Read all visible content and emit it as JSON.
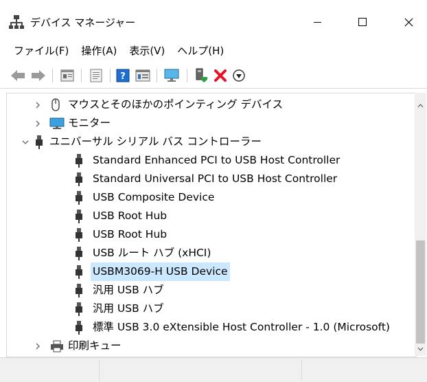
{
  "title": "デバイス マネージャー",
  "menu": [
    {
      "label": "ファイル(F)"
    },
    {
      "label": "操作(A)"
    },
    {
      "label": "表示(V)"
    },
    {
      "label": "ヘルプ(H)"
    }
  ],
  "toolbar_icons": [
    "back-icon",
    "forward-icon",
    "properties-icon",
    "update-icon",
    "help-icon",
    "view-icon",
    "monitor-icon",
    "enable-icon",
    "remove-icon",
    "install-icon"
  ],
  "tree": {
    "rows": [
      {
        "label": "マウスとそのほかのポインティング デバイス",
        "expanded": false,
        "level": 0,
        "icon": "mouse-icon"
      },
      {
        "label": "モニター",
        "expanded": false,
        "level": 0,
        "icon": "monitor-icon"
      },
      {
        "label": "ユニバーサル シリアル バス コントローラー",
        "expanded": true,
        "level": 0,
        "icon": "usb-icon"
      },
      {
        "label": "Standard Enhanced PCI to USB Host Controller",
        "level": 1,
        "icon": "usb-icon"
      },
      {
        "label": "Standard Universal PCI to USB Host Controller",
        "level": 1,
        "icon": "usb-icon"
      },
      {
        "label": "USB Composite Device",
        "level": 1,
        "icon": "usb-icon"
      },
      {
        "label": "USB Root Hub",
        "level": 1,
        "icon": "usb-icon"
      },
      {
        "label": "USB Root Hub",
        "level": 1,
        "icon": "usb-icon"
      },
      {
        "label": "USB ルート ハブ (xHCI)",
        "level": 1,
        "icon": "usb-icon"
      },
      {
        "label": "USBM3069-H USB Device",
        "level": 1,
        "icon": "usb-icon",
        "selected": true
      },
      {
        "label": "汎用 USB ハブ",
        "level": 1,
        "icon": "usb-icon"
      },
      {
        "label": "汎用 USB ハブ",
        "level": 1,
        "icon": "usb-icon"
      },
      {
        "label": "標準 USB 3.0 eXtensible Host Controller - 1.0 (Microsoft)",
        "level": 1,
        "icon": "usb-icon"
      },
      {
        "label": "印刷キュー",
        "expanded": false,
        "level": 0,
        "icon": "printer-icon"
      }
    ]
  },
  "colors": {
    "selection": "#cce8ff",
    "remove": "#e81123",
    "help": "#1e6fd0"
  }
}
